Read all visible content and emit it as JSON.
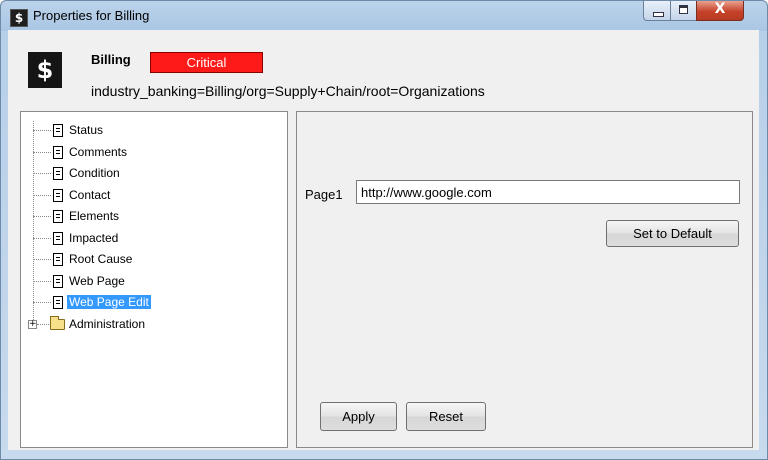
{
  "window": {
    "title": "Properties for Billing",
    "app_icon": "$",
    "controls": {
      "minimize": "minimize-icon",
      "maximize": "maximize-icon",
      "close": "X"
    }
  },
  "header": {
    "icon": "$",
    "name": "Billing",
    "severity": "Critical",
    "severity_color": "#ff1a1a",
    "path": "industry_banking=Billing/org=Supply+Chain/root=Organizations"
  },
  "tree": {
    "items": [
      {
        "label": "Status"
      },
      {
        "label": "Comments"
      },
      {
        "label": "Condition"
      },
      {
        "label": "Contact"
      },
      {
        "label": "Elements"
      },
      {
        "label": "Impacted"
      },
      {
        "label": "Root Cause"
      },
      {
        "label": "Web Page"
      },
      {
        "label": "Web Page Edit",
        "selected": true
      }
    ],
    "folder": {
      "label": "Administration",
      "expander": "+"
    },
    "selection_color": "#3399ff"
  },
  "form": {
    "page_label": "Page1",
    "page_value": "http://www.google.com",
    "set_default_label": "Set to Default",
    "apply_label": "Apply",
    "reset_label": "Reset"
  }
}
